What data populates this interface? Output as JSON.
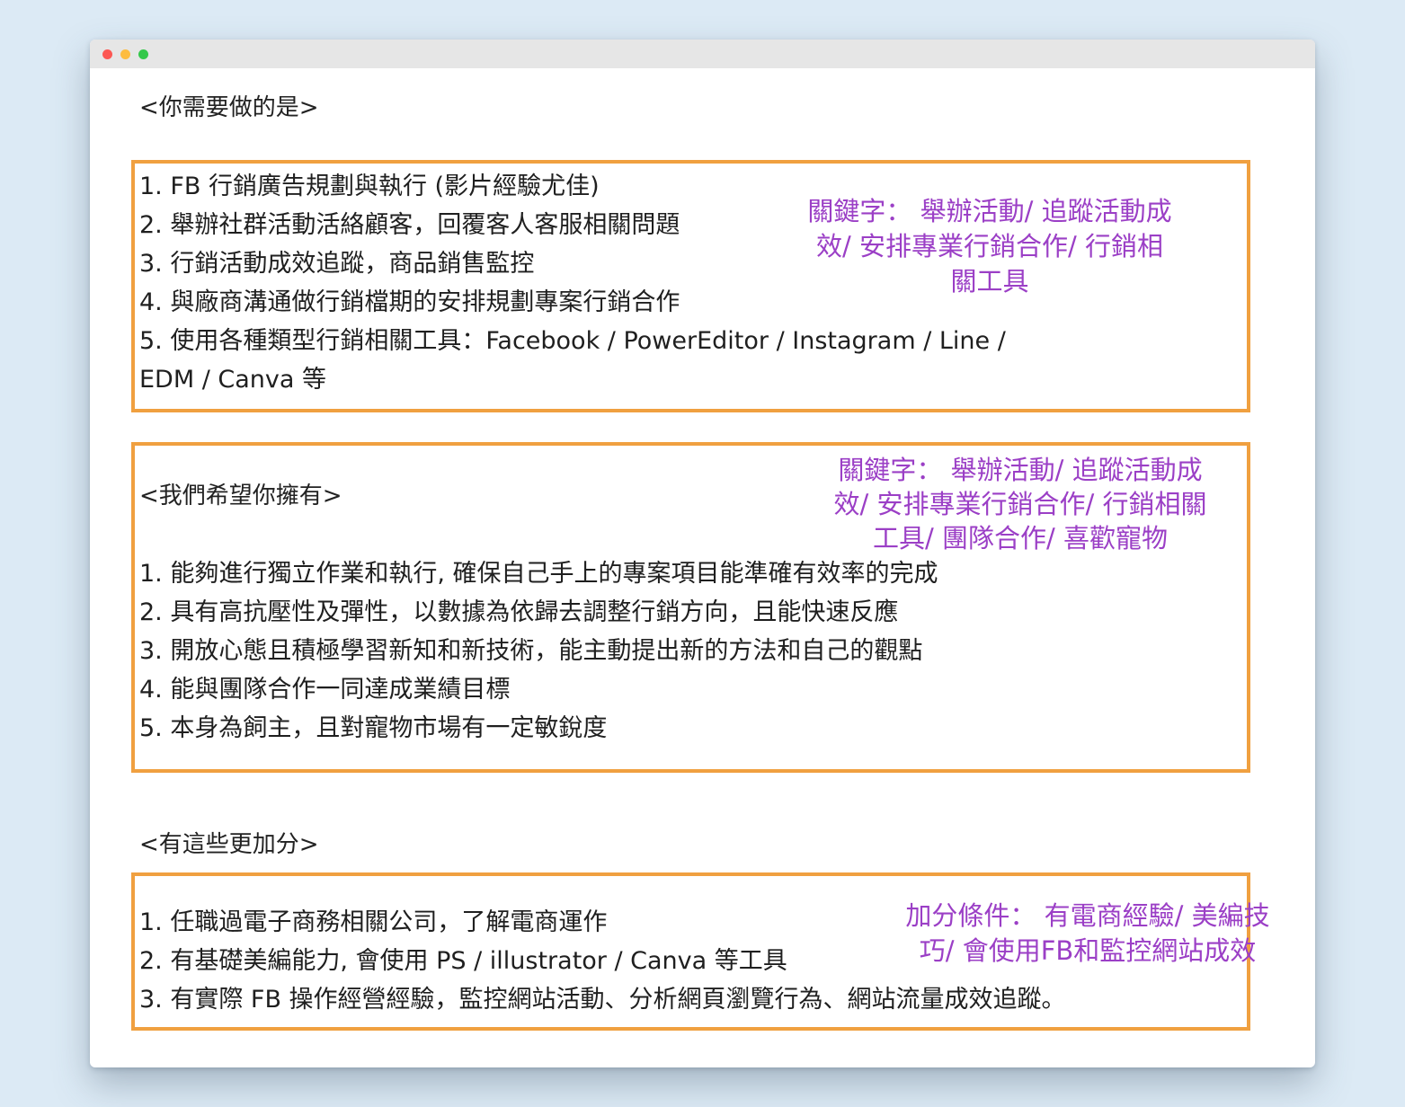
{
  "window": {
    "controls": [
      "close",
      "minimize",
      "zoom"
    ]
  },
  "section1": {
    "heading": "<你需要做的是>",
    "items": [
      "1. FB 行銷廣告規劃與執行 (影片經驗尤佳)",
      "2. 舉辦社群活動活絡顧客，回覆客人客服相關問題",
      "3. 行銷活動成效追蹤，商品銷售監控",
      "4. 與廠商溝通做行銷檔期的安排規劃專案行銷合作",
      "5. 使用各種類型行銷相關工具：Facebook / PowerEditor / Instagram / Line /",
      "EDM / Canva 等"
    ],
    "note": [
      "關鍵字：  舉辦活動/ 追蹤活動成",
      "效/ 安排專業行銷合作/ 行銷相",
      "關工具"
    ]
  },
  "section2": {
    "heading": "<我們希望你擁有>",
    "items": [
      "1. 能夠進行獨立作業和執行, 確保自己手上的專案項目能準確有效率的完成",
      "2. 具有高抗壓性及彈性，以數據為依歸去調整行銷方向，且能快速反應",
      "3. 開放心態且積極學習新知和新技術，能主動提出新的方法和自己的觀點",
      "4. 能與團隊合作一同達成業績目標",
      "5. 本身為飼主，且對寵物市場有一定敏銳度"
    ],
    "note": [
      "關鍵字：  舉辦活動/ 追蹤活動成",
      "效/ 安排專業行銷合作/ 行銷相關",
      "工具/ 團隊合作/ 喜歡寵物"
    ]
  },
  "section3": {
    "heading": "<有這些更加分>",
    "items": [
      "1. 任職過電子商務相關公司，了解電商運作",
      "2. 有基礎美編能力, 會使用 PS / illustrator / Canva 等工具",
      "3. 有實際 FB 操作經營經驗，監控網站活動、分析網頁瀏覽行為、網站流量成效追蹤。"
    ],
    "note": [
      "加分條件：  有電商經驗/ 美編技",
      "巧/ 會使用FB和監控網站成效"
    ]
  }
}
